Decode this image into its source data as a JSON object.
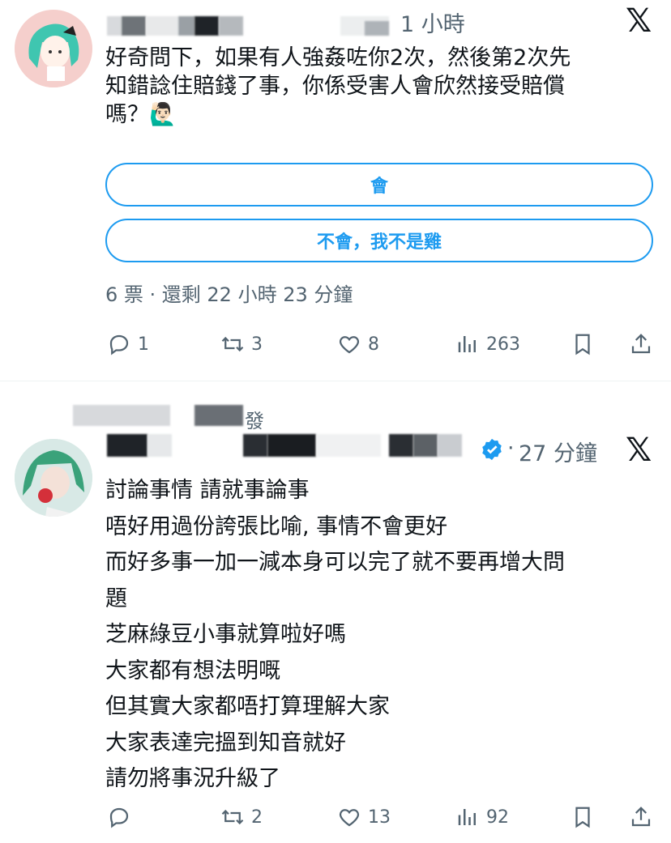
{
  "tweet1": {
    "time": "1 小時",
    "body_lines": [
      "好奇問下，如果有人強姦咗你2次，然後第2次先",
      "知錯諗住賠錢了事，你係受害人會欣然接受賠償",
      "嗎？🙋🏻‍♂️"
    ],
    "poll": {
      "options": [
        "會",
        "不會，我不是雞"
      ],
      "meta": "6 票 · 還剩 22 小時 23 分鐘"
    },
    "actions": {
      "replies": "1",
      "retweets": "3",
      "likes": "8",
      "views": "263"
    }
  },
  "tweet2": {
    "context_fragment": "發",
    "time": "27 分鐘",
    "body_lines": [
      "討論事情 請就事論事",
      "唔好用過份誇張比喻, 事情不會更好",
      "而好多事一加一減本身可以完了就不要再增大問",
      "題",
      "芝麻綠豆小事就算啦好嗎",
      "大家都有想法明嘅",
      "但其實大家都唔打算理解大家",
      "大家表達完搵到知音就好",
      "請勿將事況升級了"
    ],
    "actions": {
      "replies": "",
      "retweets": "2",
      "likes": "13",
      "views": "92"
    }
  },
  "colors": {
    "accent": "#1d9bf0",
    "muted": "#536471",
    "text": "#0f1419",
    "verified": "#1d9bf0"
  },
  "icons": {
    "reply": "reply-icon",
    "retweet": "retweet-icon",
    "like": "heart-icon",
    "views": "views-icon",
    "bookmark": "bookmark-icon",
    "share": "share-icon",
    "platform": "x-logo-icon"
  }
}
